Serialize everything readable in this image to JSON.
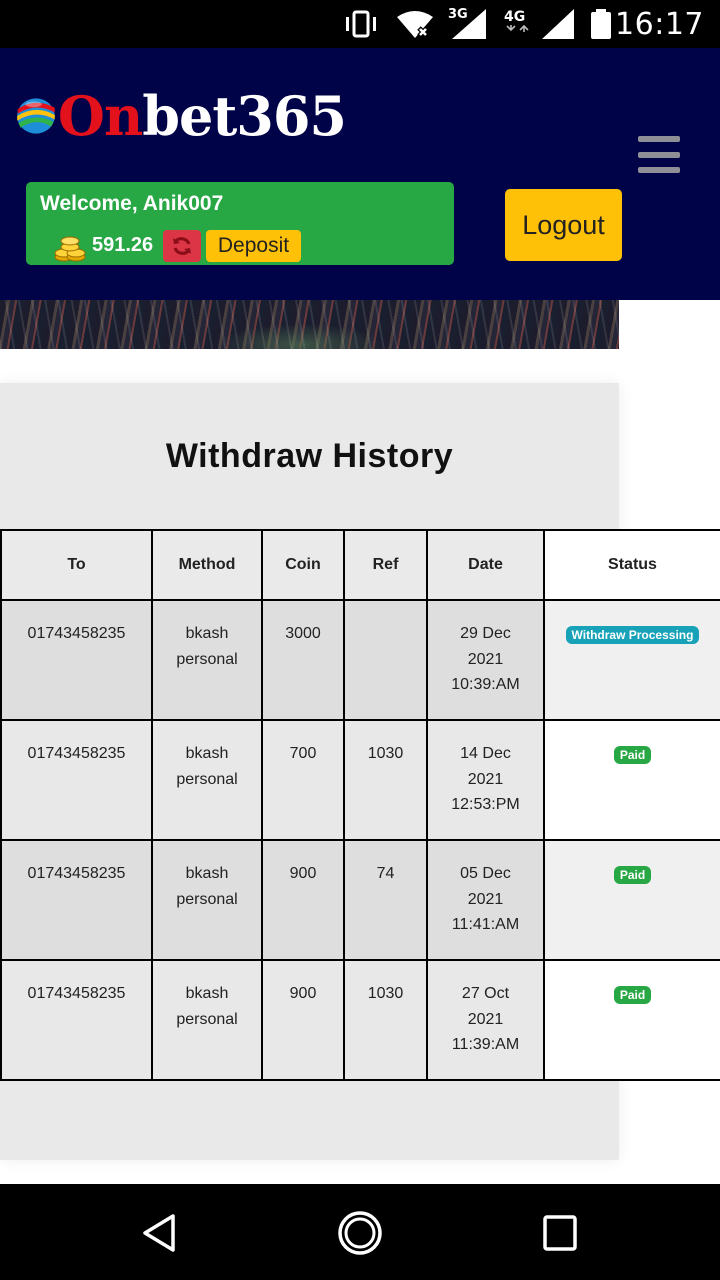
{
  "status_bar": {
    "time": "16:17",
    "network_3g": "3G",
    "network_4g": "4G",
    "icons": [
      "vibrate-icon",
      "wifi-off-icon",
      "signal-3g-icon",
      "signal-4g-icon",
      "battery-icon"
    ]
  },
  "header": {
    "logo_on": "On",
    "logo_bet": "bet365",
    "welcome": "Welcome, Anik007",
    "balance": "591.26",
    "deposit_label": "Deposit",
    "logout_label": "Logout",
    "menu_icon": "hamburger-menu-icon"
  },
  "colors": {
    "header_bg": "#000347",
    "welcome_bg": "#28a745",
    "accent_yellow": "#ffc107",
    "refresh_red": "#dc3545",
    "badge_processing": "#17a2b8",
    "badge_paid": "#28a745"
  },
  "page": {
    "title": "Withdraw History"
  },
  "table": {
    "headers": [
      "To",
      "Method",
      "Coin",
      "Ref",
      "Date",
      "Status"
    ],
    "rows": [
      {
        "to": "01743458235",
        "method_1": "bkash",
        "method_2": "personal",
        "coin": "3000",
        "ref": "",
        "date_1": "29 Dec",
        "date_2": "2021",
        "date_3": "10:39:AM",
        "status": "Withdraw Processing"
      },
      {
        "to": "01743458235",
        "method_1": "bkash",
        "method_2": "personal",
        "coin": "700",
        "ref": "1030",
        "date_1": "14 Dec",
        "date_2": "2021",
        "date_3": "12:53:PM",
        "status": "Paid"
      },
      {
        "to": "01743458235",
        "method_1": "bkash",
        "method_2": "personal",
        "coin": "900",
        "ref": "74",
        "date_1": "05 Dec",
        "date_2": "2021",
        "date_3": "11:41:AM",
        "status": "Paid"
      },
      {
        "to": "01743458235",
        "method_1": "bkash",
        "method_2": "personal",
        "coin": "900",
        "ref": "1030",
        "date_1": "27 Oct",
        "date_2": "2021",
        "date_3": "11:39:AM",
        "status": "Paid"
      }
    ]
  },
  "nav_bar": {
    "icons": [
      "back-icon",
      "home-icon",
      "recents-icon"
    ]
  }
}
